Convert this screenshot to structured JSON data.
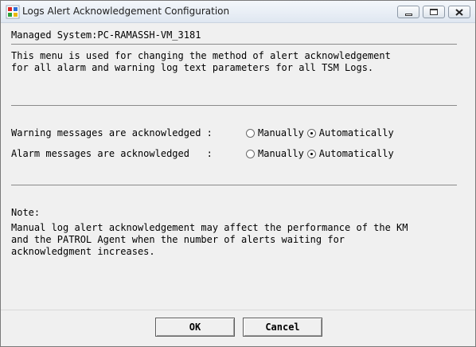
{
  "window": {
    "title": "Logs Alert Acknowledgement Configuration"
  },
  "managed_system": "Managed System:PC-RAMASSH-VM_3181",
  "description": "This menu is used for changing the method of alert acknowledgement\nfor all alarm and warning log text parameters for all TSM Logs.",
  "settings": [
    {
      "label": "Warning messages are acknowledged :",
      "options": [
        "Manually",
        "Automatically"
      ],
      "selected": "Automatically"
    },
    {
      "label": "Alarm messages are acknowledged   :",
      "options": [
        "Manually",
        "Automatically"
      ],
      "selected": "Automatically"
    }
  ],
  "note": {
    "title": "Note:",
    "text": "Manual log alert acknowledgement may affect the performance of the KM\nand the PATROL Agent when the number of alerts waiting for\nacknowledgment increases."
  },
  "buttons": {
    "ok": "OK",
    "cancel": "Cancel"
  },
  "icons": {
    "app": "patrol-app-icon",
    "minimize": "minimize-icon",
    "maximize": "maximize-icon",
    "close": "close-icon"
  }
}
